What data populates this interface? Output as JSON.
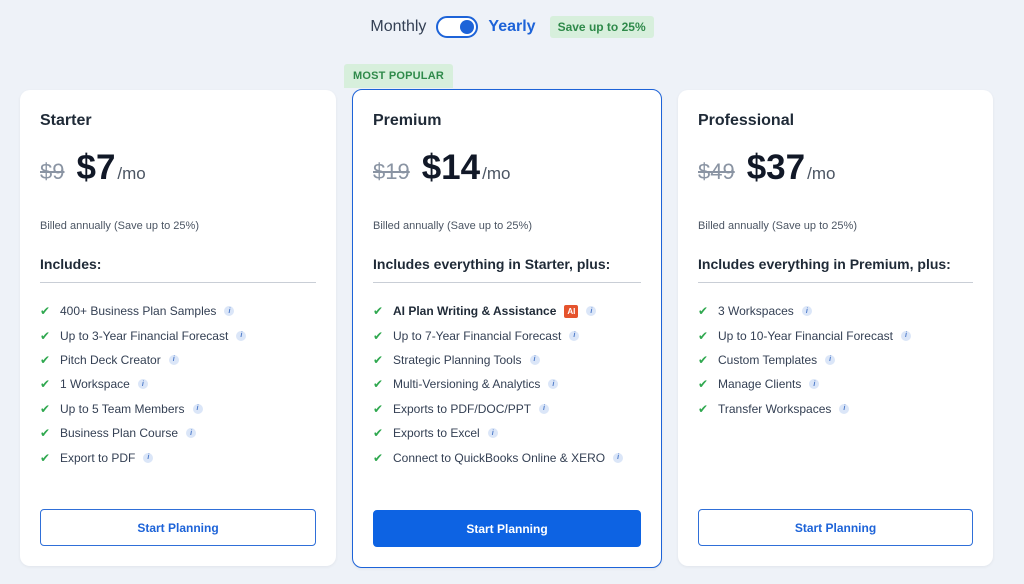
{
  "billing": {
    "monthly_label": "Monthly",
    "yearly_label": "Yearly",
    "save_badge": "Save up to 25%",
    "selected": "Yearly"
  },
  "plans": [
    {
      "name": "Starter",
      "old_price": "$9",
      "new_price": "$7",
      "per": "/mo",
      "billed": "Billed annually (Save up to 25%)",
      "includes": "Includes:",
      "features": [
        "400+ Business Plan Samples",
        "Up to 3-Year Financial Forecast",
        "Pitch Deck Creator",
        "1 Workspace",
        "Up to 5 Team Members",
        "Business Plan Course",
        "Export to PDF"
      ],
      "cta": "Start Planning"
    },
    {
      "name": "Premium",
      "badge": "MOST POPULAR",
      "old_price": "$19",
      "new_price": "$14",
      "per": "/mo",
      "billed": "Billed annually (Save up to 25%)",
      "includes": "Includes everything in Starter, plus:",
      "features": [
        "AI Plan Writing & Assistance",
        "Up to 7-Year Financial Forecast",
        "Strategic Planning Tools",
        "Multi-Versioning & Analytics",
        "Exports to PDF/DOC/PPT",
        "Exports to Excel",
        "Connect to QuickBooks Online & XERO"
      ],
      "ai_badge": "AI",
      "cta": "Start Planning"
    },
    {
      "name": "Professional",
      "old_price": "$49",
      "new_price": "$37",
      "per": "/mo",
      "billed": "Billed annually (Save up to 25%)",
      "includes": "Includes everything in Premium, plus:",
      "features": [
        "3 Workspaces",
        "Up to 10-Year Financial Forecast",
        "Custom Templates",
        "Manage Clients",
        "Transfer Workspaces"
      ],
      "cta": "Start Planning"
    }
  ],
  "icons": {
    "check": "check-icon",
    "info": "info-icon"
  },
  "colors": {
    "accent": "#1d63d8",
    "check": "#2fa84f",
    "badge_bg": "#d7efdc",
    "badge_text": "#2f8a4a",
    "ai_badge": "#e5532d"
  }
}
